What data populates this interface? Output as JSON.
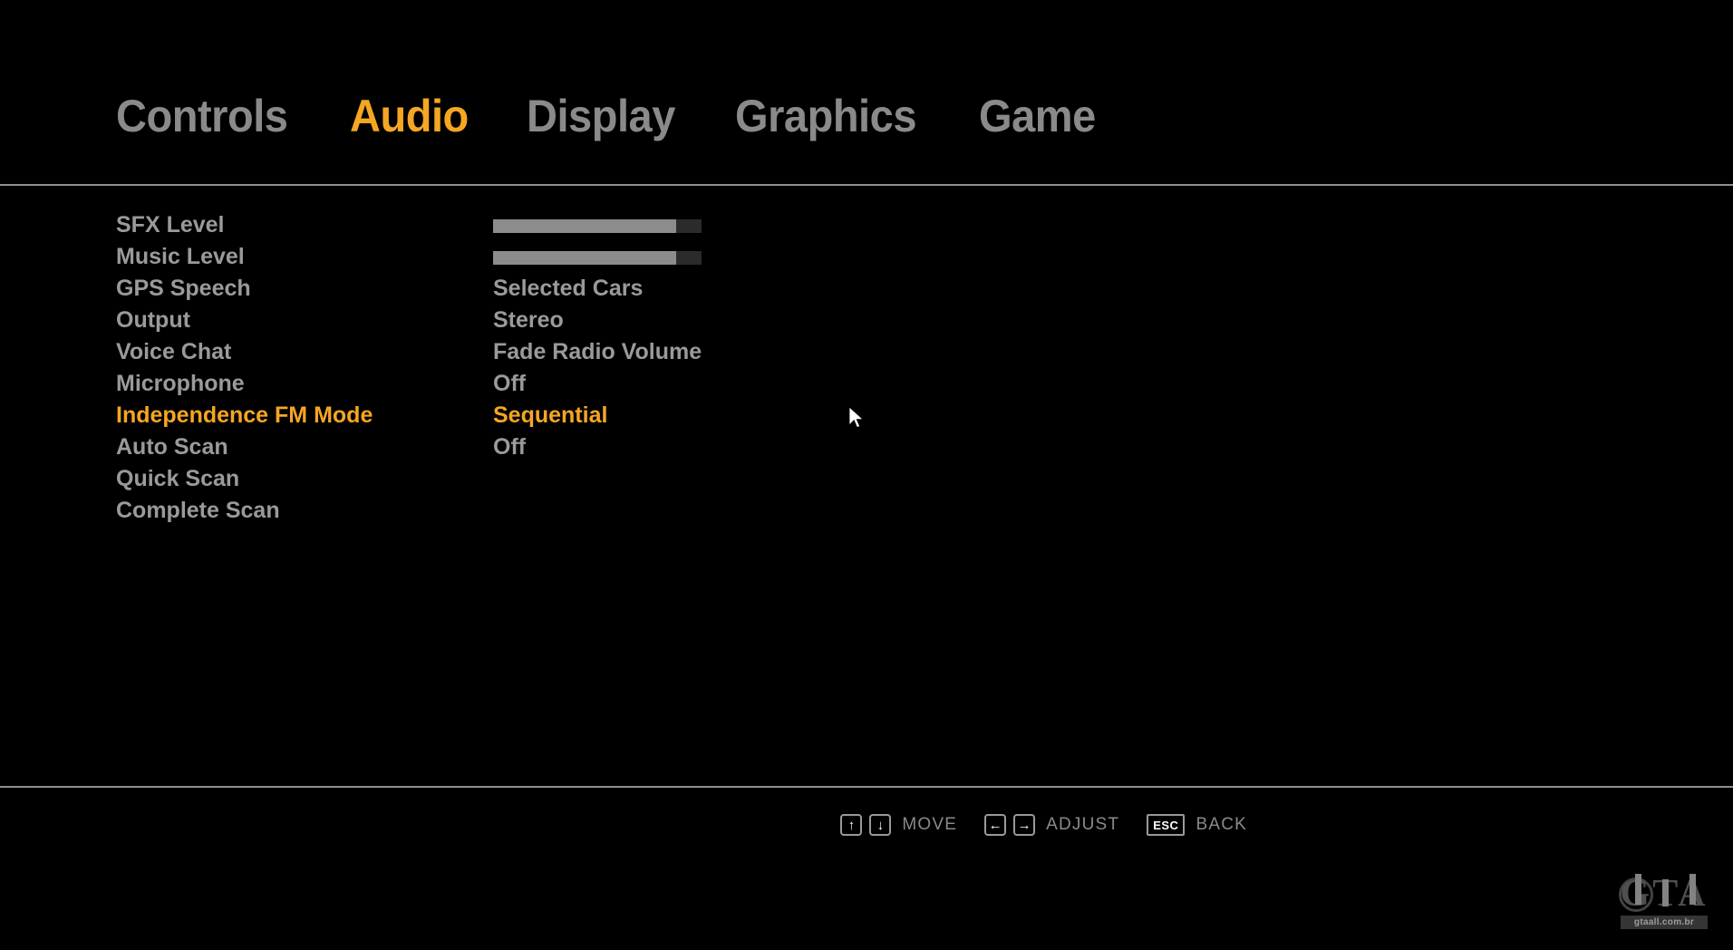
{
  "theme": {
    "background": "#000000",
    "text_color": "#9a9a9a",
    "accent_color": "#f5a623",
    "divider_color": "#8f8f8f",
    "slider_fill_color": "#8c8c8c",
    "slider_track_color": "#2b2b2b"
  },
  "tabs": [
    {
      "label": "Controls",
      "active": false
    },
    {
      "label": "Audio",
      "active": true
    },
    {
      "label": "Display",
      "active": false
    },
    {
      "label": "Graphics",
      "active": false
    },
    {
      "label": "Game",
      "active": false
    }
  ],
  "settings": [
    {
      "label": "SFX Level",
      "type": "slider",
      "value": "",
      "percent": 88,
      "selected": false
    },
    {
      "label": "Music Level",
      "type": "slider",
      "value": "",
      "percent": 88,
      "selected": false
    },
    {
      "label": "GPS Speech",
      "type": "option",
      "value": "Selected Cars",
      "selected": false
    },
    {
      "label": "Output",
      "type": "option",
      "value": "Stereo",
      "selected": false
    },
    {
      "label": "Voice Chat",
      "type": "option",
      "value": "Fade Radio Volume",
      "selected": false
    },
    {
      "label": "Microphone",
      "type": "option",
      "value": "Off",
      "selected": false
    },
    {
      "label": "Independence FM Mode",
      "type": "option",
      "value": "Sequential",
      "selected": true
    },
    {
      "label": "Auto Scan",
      "type": "option",
      "value": "Off",
      "selected": false
    },
    {
      "label": "Quick Scan",
      "type": "action",
      "value": "",
      "selected": false
    },
    {
      "label": "Complete Scan",
      "type": "action",
      "value": "",
      "selected": false
    }
  ],
  "footer_hints": [
    {
      "keys": [
        "↑",
        "↓"
      ],
      "label": "MOVE",
      "wide": false
    },
    {
      "keys": [
        "←",
        "→"
      ],
      "label": "ADJUST",
      "wide": false
    },
    {
      "keys": [
        "ESC"
      ],
      "label": "BACK",
      "wide": true
    }
  ],
  "watermark": {
    "letters": "GTA",
    "url": "gtaall.com.br"
  }
}
